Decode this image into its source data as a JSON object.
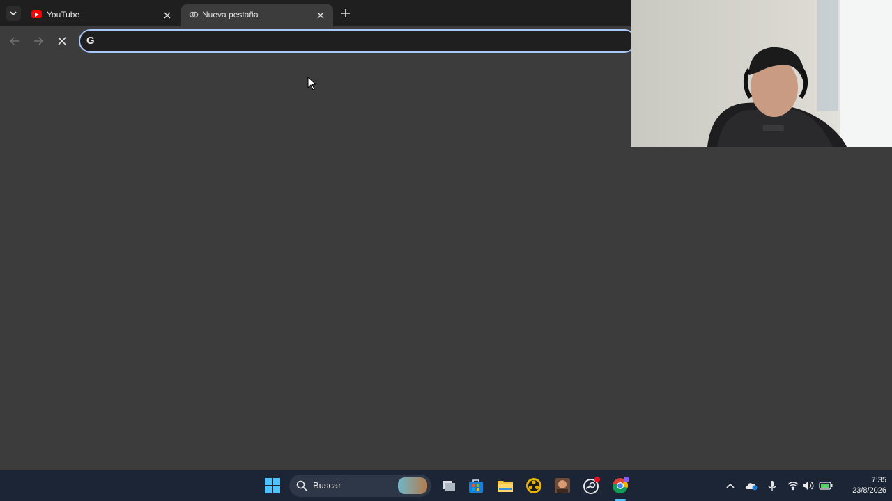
{
  "browser": {
    "tabs": [
      {
        "title": "YouTube",
        "icon": "youtube-icon",
        "active": false
      },
      {
        "title": "Nueva pestaña",
        "icon": "new-tab-icon",
        "active": true
      }
    ],
    "omnibox": {
      "value": "",
      "icon_letter": "G",
      "icon": "google-icon"
    }
  },
  "taskbar": {
    "search_label": "Buscar",
    "apps": [
      "windows-start-icon",
      "task-view-icon",
      "microsoft-store-icon",
      "file-explorer-icon",
      "obs-icon",
      "game-icon",
      "steam-icon",
      "chrome-icon"
    ],
    "tray": [
      "chevron-up-icon",
      "onedrive-icon",
      "microphone-icon",
      "wifi-icon",
      "volume-icon",
      "battery-icon"
    ],
    "time": "7:35",
    "date": "23/8/2026"
  },
  "colors": {
    "accent": "#a8c7fa",
    "content_bg": "#3c3c3c",
    "tabbar_bg": "#1f1f1f",
    "taskbar_bg": "#1c2535"
  }
}
